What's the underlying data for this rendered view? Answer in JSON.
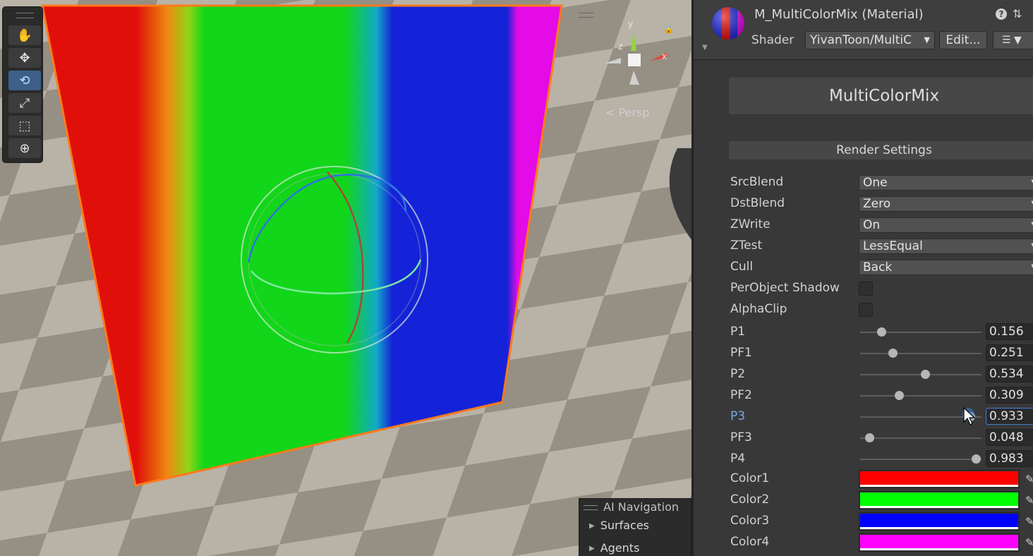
{
  "scene": {
    "persp_label": "< Persp",
    "gizmo_axes": {
      "y": "y",
      "x": "x",
      "z": "z"
    },
    "tools": [
      {
        "name": "hand-tool",
        "icon": "hand-icon"
      },
      {
        "name": "move-tool",
        "icon": "move-icon"
      },
      {
        "name": "rotate-tool",
        "icon": "rotate-icon",
        "active": true
      },
      {
        "name": "scale-tool",
        "icon": "scale-icon"
      },
      {
        "name": "rect-tool",
        "icon": "rect-icon"
      },
      {
        "name": "transform-tool",
        "icon": "transform-icon"
      }
    ],
    "ai_navigation": {
      "title": "AI Navigation",
      "items": [
        "Surfaces",
        "Agents"
      ]
    },
    "colors": {
      "red": "#e10f0a",
      "green": "#12d619",
      "blue": "#1423d8",
      "magenta": "#e40be6",
      "selection_outline": "#ff7a1a"
    }
  },
  "inspector": {
    "material_title": "M_MultiColorMix (Material)",
    "shader_label": "Shader",
    "shader_value": "YivanToon/MultiC",
    "edit_label": "Edit...",
    "banner": "MultiColorMix",
    "section_title": "Render Settings",
    "dropdowns": [
      {
        "label": "SrcBlend",
        "value": "One"
      },
      {
        "label": "DstBlend",
        "value": "Zero"
      },
      {
        "label": "ZWrite",
        "value": "On"
      },
      {
        "label": "ZTest",
        "value": "LessEqual"
      },
      {
        "label": "Cull",
        "value": "Back"
      }
    ],
    "toggles": [
      {
        "label": "PerObject Shadow",
        "checked": false
      },
      {
        "label": "AlphaClip",
        "checked": false
      }
    ],
    "sliders": [
      {
        "label": "P1",
        "value": "0.156",
        "fraction": 0.156
      },
      {
        "label": "PF1",
        "value": "0.251",
        "fraction": 0.251
      },
      {
        "label": "P2",
        "value": "0.534",
        "fraction": 0.534
      },
      {
        "label": "PF2",
        "value": "0.309",
        "fraction": 0.309
      },
      {
        "label": "P3",
        "value": "0.933",
        "fraction": 0.933,
        "active": true
      },
      {
        "label": "PF3",
        "value": "0.048",
        "fraction": 0.048
      },
      {
        "label": "P4",
        "value": "0.983",
        "fraction": 0.983
      }
    ],
    "colors": [
      {
        "label": "Color1",
        "value": "#ff0000"
      },
      {
        "label": "Color2",
        "value": "#00ff00"
      },
      {
        "label": "Color3",
        "value": "#0000ff"
      },
      {
        "label": "Color4",
        "value": "#ff00ff"
      }
    ]
  }
}
